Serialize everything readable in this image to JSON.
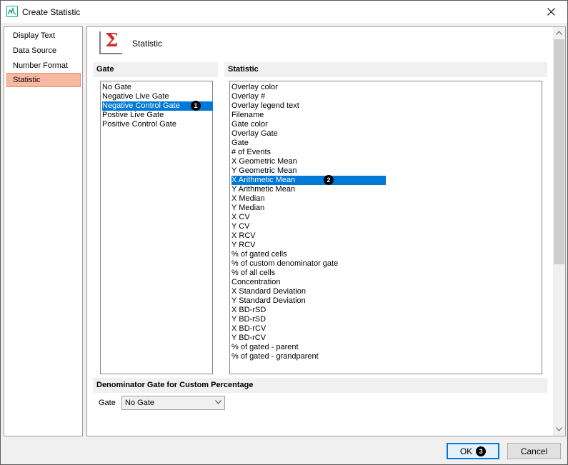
{
  "window": {
    "title": "Create Statistic"
  },
  "nav": {
    "items": [
      {
        "label": "Display Text"
      },
      {
        "label": "Data Source"
      },
      {
        "label": "Number Format"
      },
      {
        "label": "Statistic"
      }
    ],
    "selected": "Statistic"
  },
  "header": {
    "label": "Statistic"
  },
  "gate_section": {
    "title": "Gate",
    "items": [
      "No Gate",
      "Negative Live Gate",
      "Negative Control Gate",
      "Postive Live Gate",
      "Positive Control Gate"
    ],
    "selected": "Negative Control Gate",
    "badge": "1"
  },
  "statistic_section": {
    "title": "Statistic",
    "items": [
      "Overlay color",
      "Overlay #",
      "Overlay legend text",
      "Filename",
      "Gate color",
      "Overlay Gate",
      "Gate",
      "# of Events",
      "X Geometric Mean",
      "Y Geometric Mean",
      "X Arithmetic Mean",
      "Y Arithmetic Mean",
      "X Median",
      "Y Median",
      "X CV",
      "Y CV",
      "X RCV",
      "Y RCV",
      "% of gated cells",
      "% of custom denominator gate",
      "% of all cells",
      "Concentration",
      "X Standard Deviation",
      "Y Standard Deviation",
      "X BD-rSD",
      "Y BD-rSD",
      "X BD-rCV",
      "Y BD-rCV",
      "% of gated - parent",
      "% of gated - grandparent"
    ],
    "selected": "X Arithmetic Mean",
    "badge": "2"
  },
  "denominator_section": {
    "title": "Denominator Gate for Custom Percentage",
    "gate_label": "Gate",
    "gate_value": "No Gate"
  },
  "buttons": {
    "ok_label": "OK",
    "ok_badge": "3",
    "cancel_label": "Cancel"
  },
  "colors": {
    "selection": "#0078d7",
    "nav_selected": "#f7b9a2",
    "sigma": "#d12b2b"
  }
}
